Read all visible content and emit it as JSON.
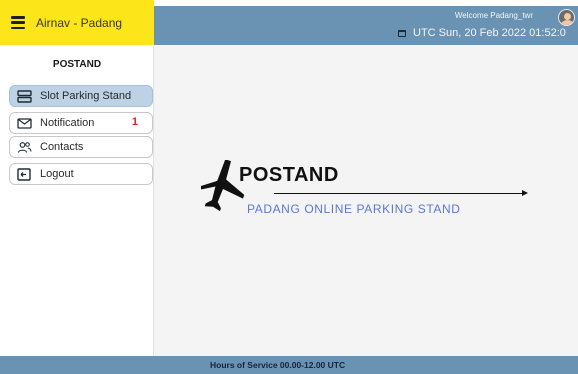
{
  "brand": {
    "name": "Airnav - Padang"
  },
  "header": {
    "welcome": "Welcome Padang_twr",
    "datetime": "UTC Sun, 20 Feb 2022 01:52:0",
    "bar_color": "#6a92b2",
    "brand_color": "#fce518"
  },
  "sidebar": {
    "title": "POSTAND",
    "items": [
      {
        "label": "Slot Parking Stand",
        "icon": "parking-slot-icon",
        "active": true
      },
      {
        "label": "Notification",
        "icon": "mail-icon",
        "badge": "1"
      },
      {
        "label": "Contacts",
        "icon": "contacts-icon"
      },
      {
        "label": "Logout",
        "icon": "logout-icon"
      }
    ]
  },
  "hero": {
    "title": "POSTAND",
    "subtitle": "PADANG ONLINE PARKING STAND",
    "icon": "airplane-icon",
    "subtitle_color": "#5b78d6"
  },
  "footer": {
    "text": "Hours of Service 00.00-12.00 UTC"
  }
}
